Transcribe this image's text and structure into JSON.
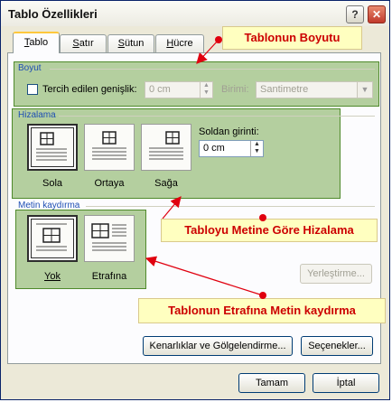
{
  "window": {
    "title": "Tablo Özellikleri",
    "help_label": "?",
    "close_label": "✕"
  },
  "tabs": [
    {
      "label": "Tablo",
      "underline": "T",
      "rest": "ablo"
    },
    {
      "label": "Satır",
      "underline": "S",
      "rest": "atır"
    },
    {
      "label": "Sütun",
      "underline": "S",
      "rest": "ütun"
    },
    {
      "label": "Hücre",
      "underline": "H",
      "rest": "ücre"
    }
  ],
  "size": {
    "section_label": "Boyut",
    "preferred_width_label": "Tercih edilen genişlik:",
    "preferred_width_checked": false,
    "width_value": "0 cm",
    "unit_label": "Birimi:",
    "unit_value": "Santimetre"
  },
  "alignment": {
    "section_label": "Hizalama",
    "options": [
      {
        "label": "Sola",
        "selected": true
      },
      {
        "label": "Ortaya",
        "selected": false
      },
      {
        "label": "Sağa",
        "selected": false
      }
    ],
    "indent_label": "Soldan girinti:",
    "indent_value": "0 cm"
  },
  "text_wrapping": {
    "section_label": "Metin kaydırma",
    "options": [
      {
        "label": "Yok",
        "selected": true
      },
      {
        "label": "Etrafına",
        "selected": false
      }
    ],
    "positioning_button": "Yerleştirme..."
  },
  "buttons": {
    "borders_shading": "Kenarlıklar ve Gölgelendirme...",
    "options": "Seçenekler...",
    "ok": "Tamam",
    "cancel": "İptal"
  },
  "callouts": {
    "size": "Tablonun Boyutu",
    "alignment": "Tabloyu Metine Göre Hizalama",
    "wrapping": "Tablonun Etrafına Metin kaydırma"
  },
  "colors": {
    "callout_text": "#cc0000",
    "callout_bg": "#ffffc0",
    "highlight": "#78aa50",
    "arrow": "#e0000f"
  }
}
